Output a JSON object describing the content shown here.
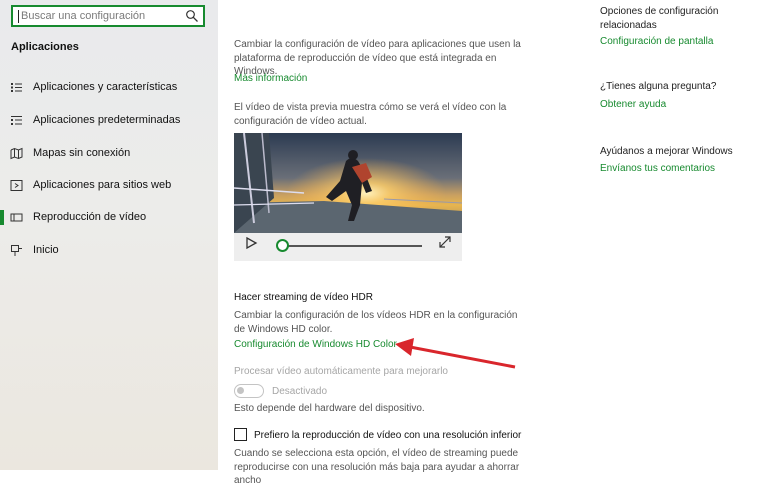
{
  "sidebar": {
    "search_placeholder": "Buscar una configuración",
    "section_title": "Aplicaciones",
    "items": [
      {
        "label": "Aplicaciones y características",
        "icon": "list-icon"
      },
      {
        "label": "Aplicaciones predeterminadas",
        "icon": "default-apps-icon"
      },
      {
        "label": "Mapas sin conexión",
        "icon": "map-icon"
      },
      {
        "label": "Aplicaciones para sitios web",
        "icon": "web-apps-icon"
      },
      {
        "label": "Reproducción de vídeo",
        "icon": "video-icon",
        "active": true
      },
      {
        "label": "Inicio",
        "icon": "startup-icon"
      }
    ]
  },
  "main": {
    "intro_text": "Cambiar la configuración de vídeo para aplicaciones que usen la plataforma de reproducción de vídeo que está integrada en Windows.",
    "more_info": "Más información",
    "preview_text": "El vídeo de vista previa muestra cómo se verá el vídeo con la configuración de vídeo actual.",
    "hdr_heading": "Hacer streaming de vídeo HDR",
    "hdr_text": "Cambiar la configuración de los vídeos HDR en la configuración de Windows HD color.",
    "hdr_link": "Configuración de Windows HD Color",
    "process_label": "Procesar vídeo automáticamente para mejorarlo",
    "toggle_state": "Desactivado",
    "hardware_note": "Esto depende del hardware del dispositivo.",
    "low_res_label": "Prefiero la reproducción de vídeo con una resolución inferior",
    "low_res_desc": "Cuando se selecciona esta opción, el vídeo de streaming puede reproducirse con una resolución más baja para ayudar a ahorrar ancho"
  },
  "right": {
    "related_title": "Opciones de configuración relacionadas",
    "display_link": "Configuración de pantalla",
    "question_title": "¿Tienes alguna pregunta?",
    "help_link": "Obtener ayuda",
    "improve_title": "Ayúdanos a mejorar Windows",
    "feedback_link": "Envíanos tus comentarios"
  },
  "colors": {
    "accent": "#178a2f",
    "annotation_arrow": "#d9262c"
  }
}
